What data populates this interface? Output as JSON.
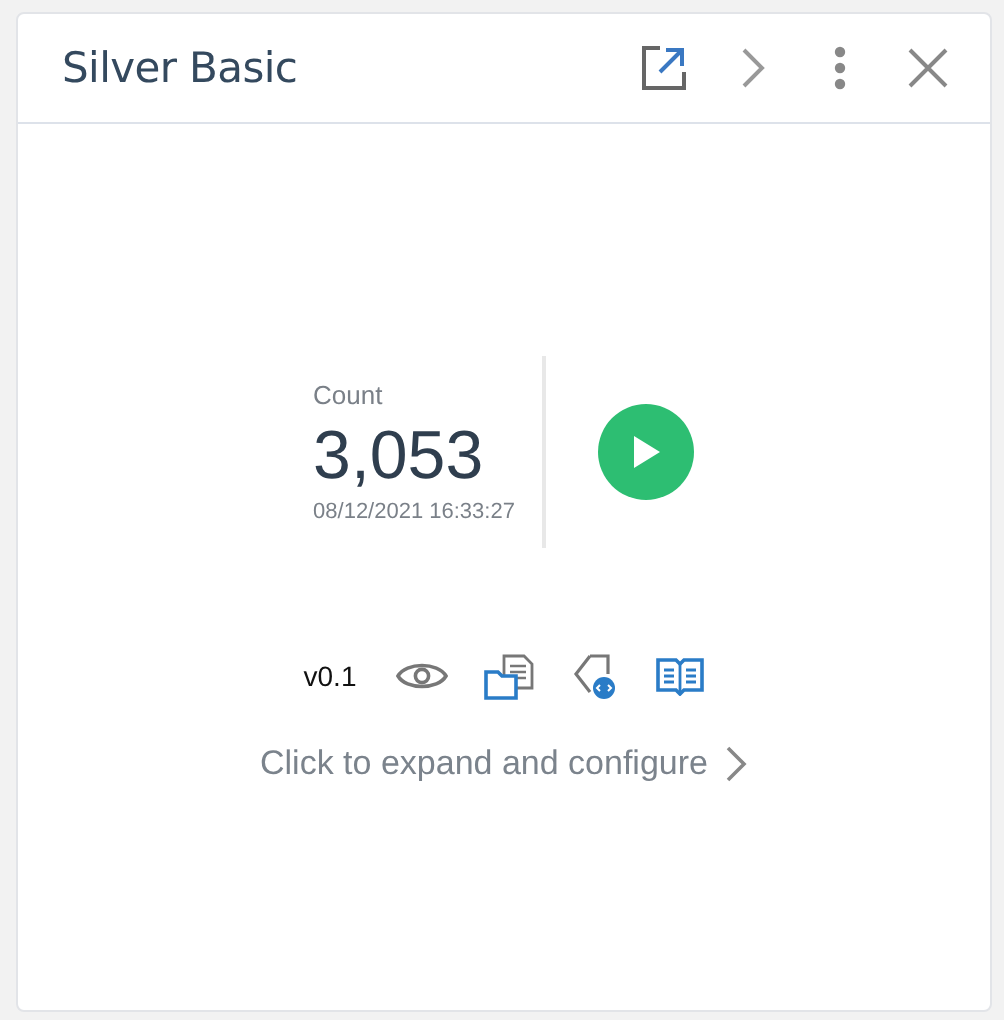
{
  "window": {
    "title": "Silver Basic"
  },
  "metric": {
    "label": "Count",
    "value": "3,053",
    "timestamp": "08/12/2021 16:33:27"
  },
  "version": "v0.1",
  "expand_link": {
    "label": "Click to expand and configure"
  }
}
